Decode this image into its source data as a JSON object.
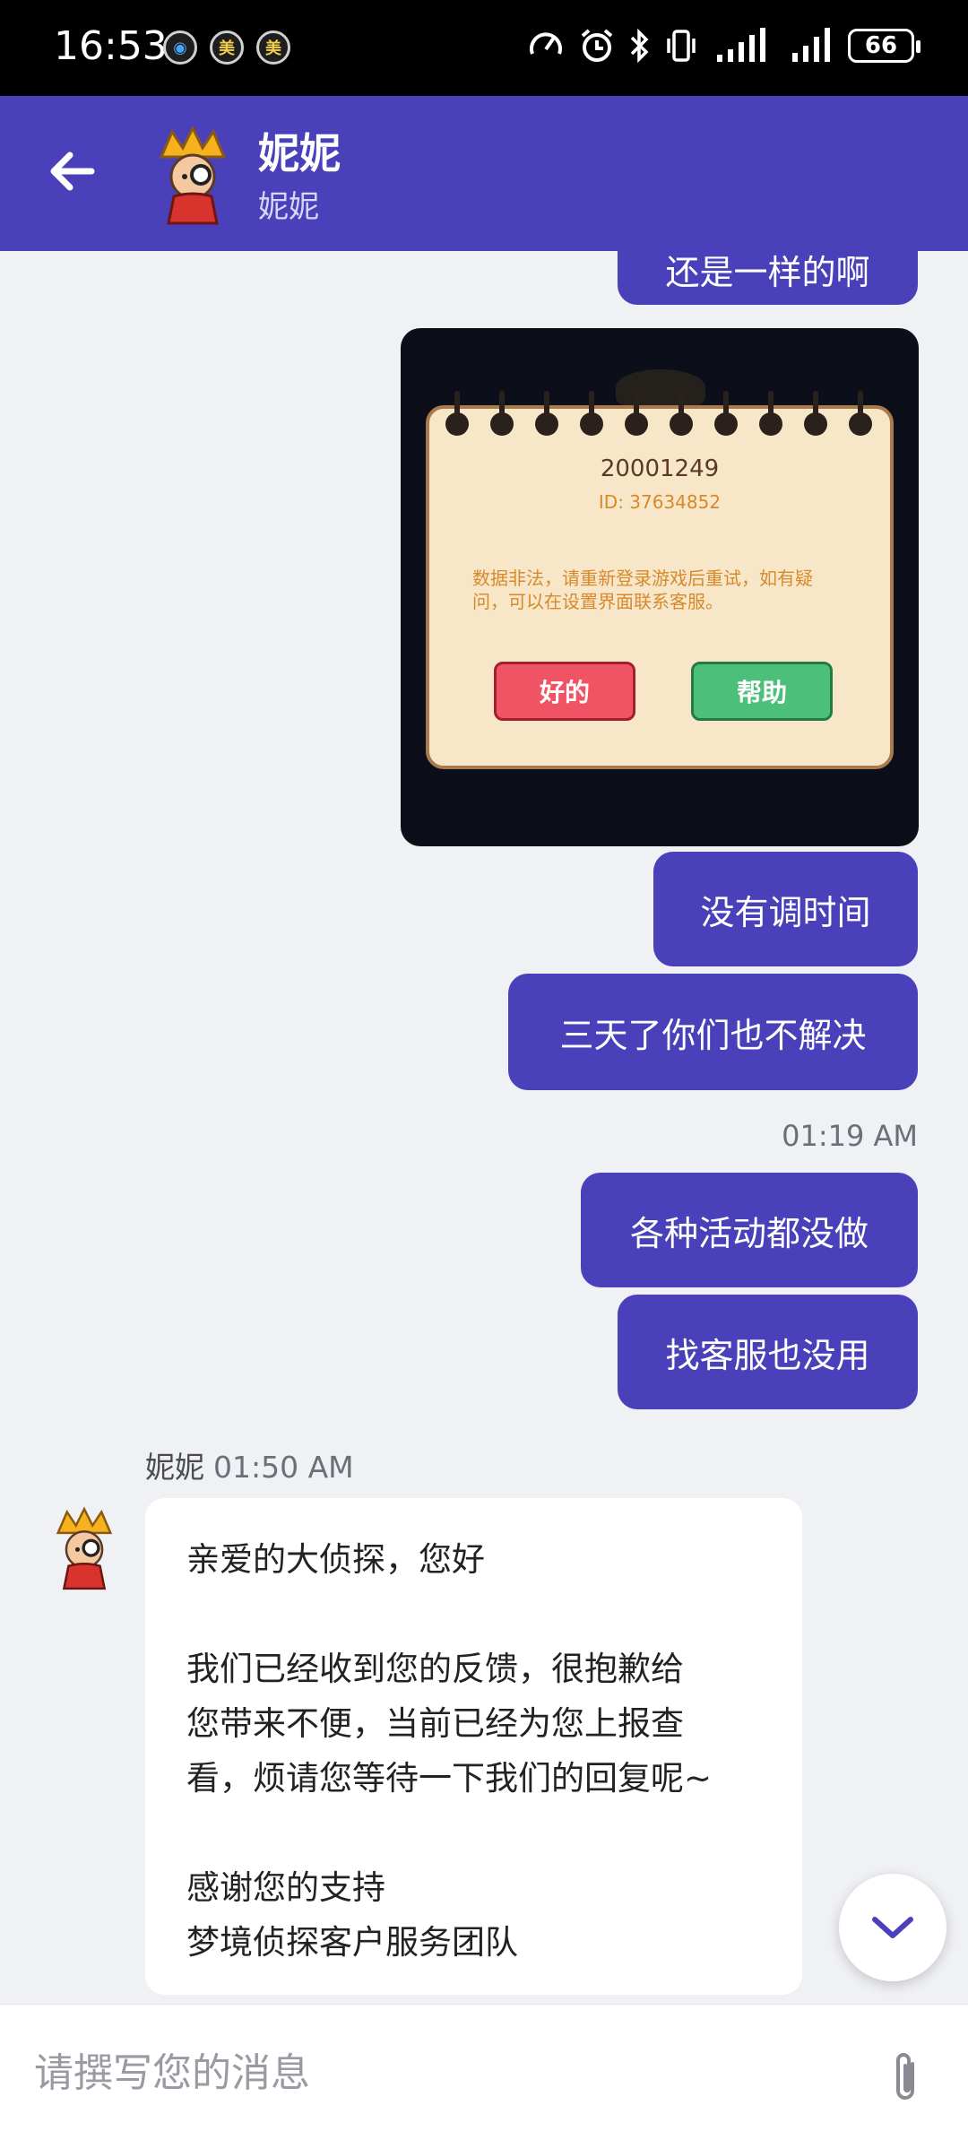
{
  "status_bar": {
    "time": "16:53",
    "left_badges": [
      "◉",
      "美",
      "美"
    ],
    "battery": "66"
  },
  "header": {
    "title": "妮妮",
    "subtitle": "妮妮"
  },
  "messages": {
    "cut_off_message": "还是一样的啊",
    "image": {
      "code": "20001249",
      "id_line": "ID: 37634852",
      "body": "数据非法，请重新登录游戏后重试，如有疑问，可以在设置界面联系客服。",
      "ok_button": "好的",
      "help_button": "帮助"
    },
    "out_1": "没有调时间",
    "out_2": "三天了你们也不解决",
    "timestamp": "01:19 AM",
    "out_3": "各种活动都没做",
    "out_4": "找客服也没用",
    "reply": {
      "sender": "妮妮",
      "time": "01:50 AM",
      "text": "亲爱的大侦探，您好\n\n我们已经收到您的反馈，很抱歉给\n您带来不便，当前已经为您上报查\n看，烦请您等待一下我们的回复呢~\n\n感谢您的支持\n梦境侦探客户服务团队"
    }
  },
  "composer": {
    "placeholder": "请撰写您的消息"
  },
  "colors": {
    "primary": "#4a40b9",
    "background": "#f0f1f5"
  },
  "icons": {
    "back": "arrow-left-icon",
    "scroll": "chevron-down-icon",
    "attach": "paperclip-icon"
  }
}
